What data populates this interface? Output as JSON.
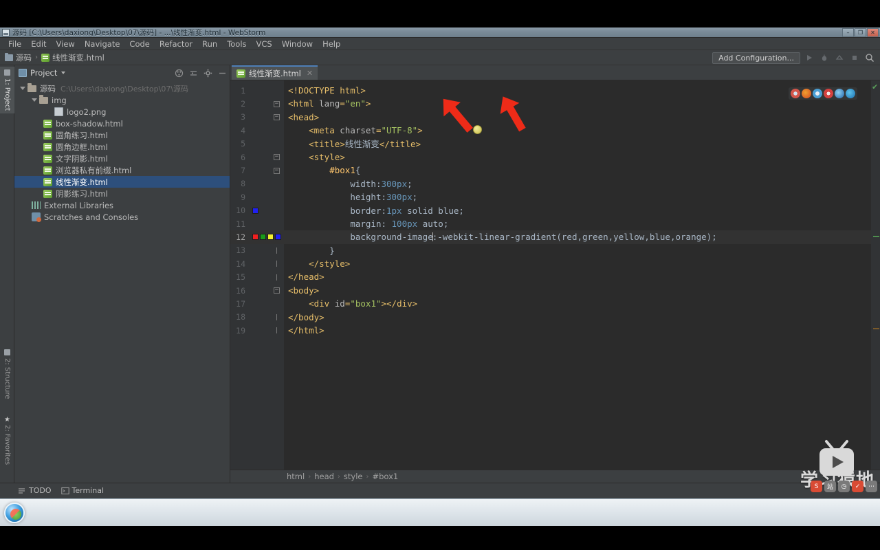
{
  "window": {
    "title": "源码 [C:\\Users\\daxiong\\Desktop\\07\\源码] - ...\\线性渐变.html - WebStorm",
    "minimize_label": "–",
    "maximize_label": "❐",
    "close_label": "✕"
  },
  "menu": {
    "items": [
      {
        "label": "File"
      },
      {
        "label": "Edit"
      },
      {
        "label": "View"
      },
      {
        "label": "Navigate"
      },
      {
        "label": "Code"
      },
      {
        "label": "Refactor"
      },
      {
        "label": "Run"
      },
      {
        "label": "Tools"
      },
      {
        "label": "VCS"
      },
      {
        "label": "Window"
      },
      {
        "label": "Help"
      }
    ]
  },
  "navbar": {
    "crumb_project": "源码",
    "crumb_file": "线性渐变.html",
    "separator": "›",
    "add_configuration": "Add Configuration...",
    "icons": [
      "run-icon",
      "debug-icon",
      "run-coverage-icon",
      "stop-icon",
      "search-icon"
    ]
  },
  "toolstrip": {
    "project_tab": "1: Project",
    "structure_tab": "2: Structure",
    "favorites_tab": "2: Favorites"
  },
  "project_panel": {
    "title": "Project",
    "header_icons": [
      "collapse-all-icon",
      "flatten-packages-icon",
      "settings-gear-icon",
      "hide-panel-icon"
    ],
    "tree": [
      {
        "label": "源码",
        "path": "C:\\Users\\daxiong\\Desktop\\07\\源码",
        "icon": "folder-icon",
        "indent": 0,
        "twisty": "expanded",
        "selected": false
      },
      {
        "label": "img",
        "path": "",
        "icon": "folder-icon",
        "indent": 1,
        "twisty": "expanded",
        "selected": false
      },
      {
        "label": "logo2.png",
        "path": "",
        "icon": "image-file-icon",
        "indent": 2,
        "twisty": "none",
        "selected": false
      },
      {
        "label": "box-shadow.html",
        "path": "",
        "icon": "html-file-icon",
        "indent": 1,
        "twisty": "none",
        "selected": false
      },
      {
        "label": "圆角练习.html",
        "path": "",
        "icon": "html-file-icon",
        "indent": 1,
        "twisty": "none",
        "selected": false
      },
      {
        "label": "圆角边框.html",
        "path": "",
        "icon": "html-file-icon",
        "indent": 1,
        "twisty": "none",
        "selected": false
      },
      {
        "label": "文字阴影.html",
        "path": "",
        "icon": "html-file-icon",
        "indent": 1,
        "twisty": "none",
        "selected": false
      },
      {
        "label": "浏览器私有前缀.html",
        "path": "",
        "icon": "html-file-icon",
        "indent": 1,
        "twisty": "none",
        "selected": false
      },
      {
        "label": "线性渐变.html",
        "path": "",
        "icon": "html-file-icon",
        "indent": 1,
        "twisty": "none",
        "selected": true
      },
      {
        "label": "阴影练习.html",
        "path": "",
        "icon": "html-file-icon",
        "indent": 1,
        "twisty": "none",
        "selected": false
      },
      {
        "label": "External Libraries",
        "path": "",
        "icon": "library-icon",
        "indent": 0,
        "twisty": "none",
        "selected": false
      },
      {
        "label": "Scratches and Consoles",
        "path": "",
        "icon": "scratches-icon",
        "indent": 0,
        "twisty": "none",
        "selected": false
      }
    ]
  },
  "editor": {
    "tab_label": "线性渐变.html",
    "tab_close": "✕",
    "browsers": [
      {
        "name": "chrome-icon",
        "color": "#d4564a"
      },
      {
        "name": "firefox-icon",
        "color": "#e06b2a"
      },
      {
        "name": "safari-icon",
        "color": "#4a9fd4"
      },
      {
        "name": "opera-icon",
        "color": "#d4413f"
      },
      {
        "name": "internet-explorer-icon",
        "color": "#2e86c8"
      },
      {
        "name": "edge-icon",
        "color": "#2b8fc9"
      }
    ],
    "gutter_swatches": {
      "line10": [
        "#2020f0"
      ],
      "line12": [
        "#ef2020",
        "#1a9b1a",
        "#f2f030",
        "#2020f0"
      ]
    },
    "lines": [
      {
        "n": "1",
        "indent": 0,
        "text": "<!DOCTYPE html>"
      },
      {
        "n": "2",
        "indent": 0,
        "text": "<html lang=\"en\">"
      },
      {
        "n": "3",
        "indent": 0,
        "text": "<head>"
      },
      {
        "n": "4",
        "indent": 1,
        "text": "<meta charset=\"UTF-8\">"
      },
      {
        "n": "5",
        "indent": 1,
        "text": "<title>线性渐变</title>"
      },
      {
        "n": "6",
        "indent": 1,
        "text": "<style>"
      },
      {
        "n": "7",
        "indent": 2,
        "text": "#box1{"
      },
      {
        "n": "8",
        "indent": 3,
        "text": "width:300px;"
      },
      {
        "n": "9",
        "indent": 3,
        "text": "height:300px;"
      },
      {
        "n": "10",
        "indent": 3,
        "text": "border:1px solid blue;"
      },
      {
        "n": "11",
        "indent": 3,
        "text": "margin: 100px auto;"
      },
      {
        "n": "12",
        "indent": 3,
        "text": "background-image:-webkit-linear-gradient(red,green,yellow,blue,orange);"
      },
      {
        "n": "13",
        "indent": 2,
        "text": "}"
      },
      {
        "n": "14",
        "indent": 1,
        "text": "</style>"
      },
      {
        "n": "15",
        "indent": 0,
        "text": "</head>"
      },
      {
        "n": "16",
        "indent": 0,
        "text": "<body>"
      },
      {
        "n": "17",
        "indent": 1,
        "text": "<div id=\"box1\"></div>"
      },
      {
        "n": "18",
        "indent": 0,
        "text": "</body>"
      },
      {
        "n": "19",
        "indent": 0,
        "text": "</html>"
      }
    ]
  },
  "breadcrumb": {
    "items": [
      "html",
      "head",
      "style",
      "#box1"
    ],
    "separator": "›"
  },
  "bottom_bar": {
    "todo_label": "TODO",
    "terminal_label": "Terminal"
  },
  "watermark": {
    "text": "学习猿地",
    "badges": [
      {
        "name": "badge-sina",
        "glyph": "S",
        "color": "#d94b34"
      },
      {
        "name": "badge-text",
        "glyph": "站",
        "color": "#6f6f6f"
      },
      {
        "name": "badge-clock",
        "glyph": "◷",
        "color": "#6f6f6f"
      },
      {
        "name": "badge-check",
        "glyph": "✓",
        "color": "#d94b34"
      },
      {
        "name": "badge-more",
        "glyph": "⋯",
        "color": "#6f6f6f"
      }
    ]
  },
  "annotations": {
    "arrow_count": 2,
    "dot_color": "#ddd46a"
  },
  "taskbar": {
    "start_label": "start-orb-icon"
  }
}
